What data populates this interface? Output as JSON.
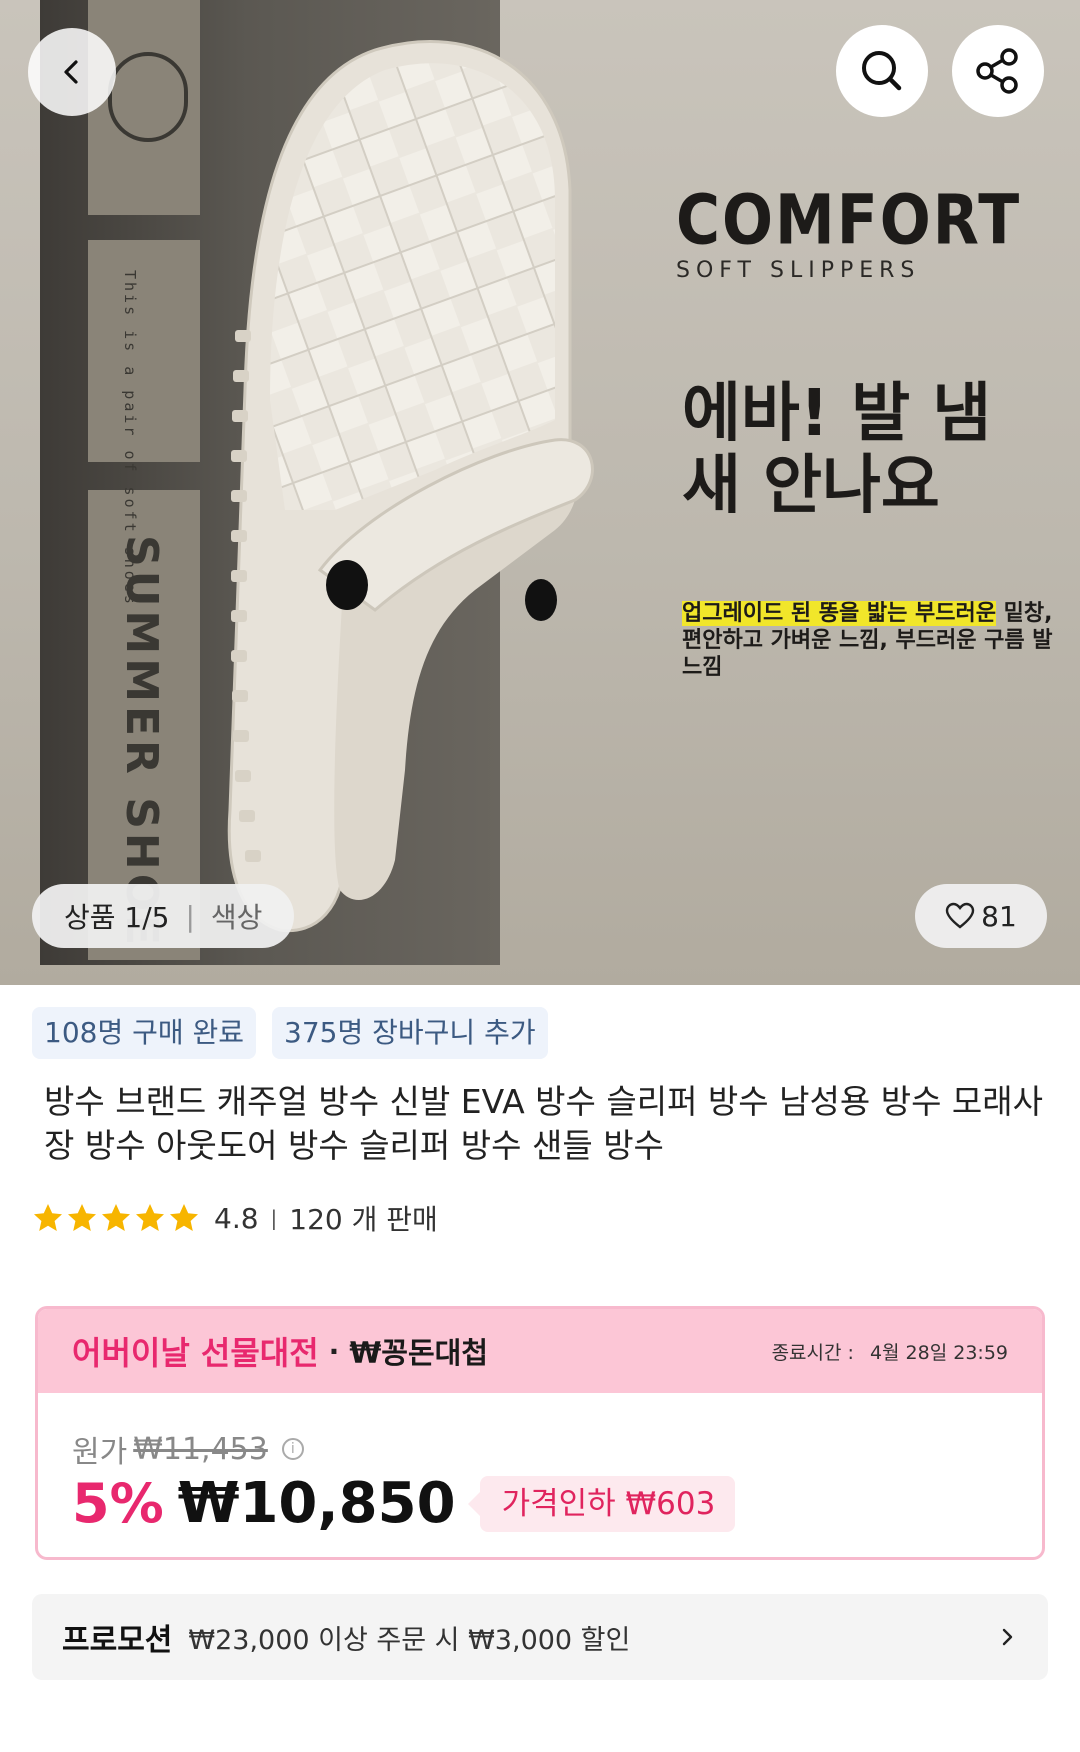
{
  "hero": {
    "box_text_small": "This is a pair of soft shoes",
    "box_text_big": "SUMMER SHOE",
    "brand_title": "COMFORT",
    "brand_subtitle": "SOFT SLIPPERS",
    "headline": "에바! 발 냄새 안나요",
    "desc_highlight": "업그레이드 된 똥을 밟는 부드러운",
    "desc_rest": " 밑창, 편안하고 가벼운 느낌, 부드러운 구름 발 느낌",
    "counter": "상품 1/5",
    "color_label": "색상",
    "likes": "81"
  },
  "tags": [
    "108명 구매 완료",
    "375명 장바구니 추가"
  ],
  "product": {
    "title": "방수 브랜드 캐주얼 방수 신발 EVA 방수 슬리퍼 방수 남성용 방수 모래사장 방수 아웃도어 방수 슬리퍼 방수 샌들 방수",
    "rating": "4.8",
    "rating_value": 4.8,
    "sold": "120 개 판매"
  },
  "promo_card": {
    "event_name": "어버이날 선물대전",
    "event_sub": "₩꽁돈대첩",
    "end_label": "종료시간 :",
    "end_time": "4월 28일 23:59",
    "orig_label": "원가",
    "orig_price": "₩11,453",
    "discount": "5%",
    "price": "₩10,850",
    "price_drop": "가격인하 ₩603"
  },
  "promotion": {
    "label": "프로모션",
    "text": "₩23,000 이상 주문 시 ₩3,000 할인"
  },
  "colors": {
    "accent_pink": "#e8286e",
    "tag_bg": "#eef3fb",
    "star": "#f7b500"
  }
}
